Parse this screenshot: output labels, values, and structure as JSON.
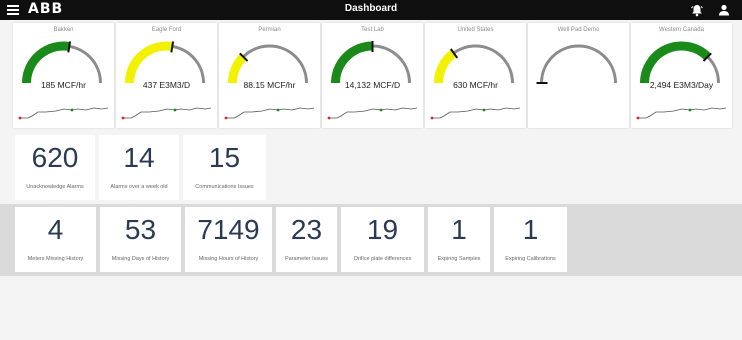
{
  "header": {
    "logo": "ABB",
    "title": "Dashboard"
  },
  "gauges": [
    {
      "name": "Bakken",
      "value": "185 MCF/hr",
      "color": "#1a8a1a",
      "fill_fraction": 0.55
    },
    {
      "name": "Eagle Ford",
      "value": "437 E3M3/D",
      "color": "#f2f200",
      "fill_fraction": 0.55
    },
    {
      "name": "Permian",
      "value": "88.15 MCF/hr",
      "color": "#f2f200",
      "fill_fraction": 0.25
    },
    {
      "name": "Test Lab",
      "value": "14,132 MCF/D",
      "color": "#1a8a1a",
      "fill_fraction": 0.5
    },
    {
      "name": "United States",
      "value": "630 MCF/hr",
      "color": "#f2f200",
      "fill_fraction": 0.3
    },
    {
      "name": "Well Pad Demo",
      "value": "",
      "color": "#1a8a1a",
      "fill_fraction": 0.0
    },
    {
      "name": "Western Canada",
      "value": "2,494 E3M3/Day",
      "color": "#1a8a1a",
      "fill_fraction": 0.75
    }
  ],
  "alarm_tiles": [
    {
      "value": "620",
      "label": "Unacknowledge Alarms"
    },
    {
      "value": "14",
      "label": "Alarms over a week old"
    },
    {
      "value": "15",
      "label": "Communications Issues"
    }
  ],
  "history_tiles": [
    {
      "value": "4",
      "label": "Meters Missing History"
    },
    {
      "value": "53",
      "label": "Missing Days of History"
    },
    {
      "value": "7149",
      "label": "Missing Hours of History"
    },
    {
      "value": "23",
      "label": "Parameter Issues"
    },
    {
      "value": "19",
      "label": "Orifice plate differences"
    },
    {
      "value": "1",
      "label": "Expiring Samples"
    },
    {
      "value": "1",
      "label": "Expiring Calibrations"
    }
  ],
  "colors": {
    "accent_green": "#1a8a1a",
    "accent_yellow": "#f2f200",
    "gauge_track": "#8c8c8c",
    "tile_number": "#2a3a55"
  }
}
